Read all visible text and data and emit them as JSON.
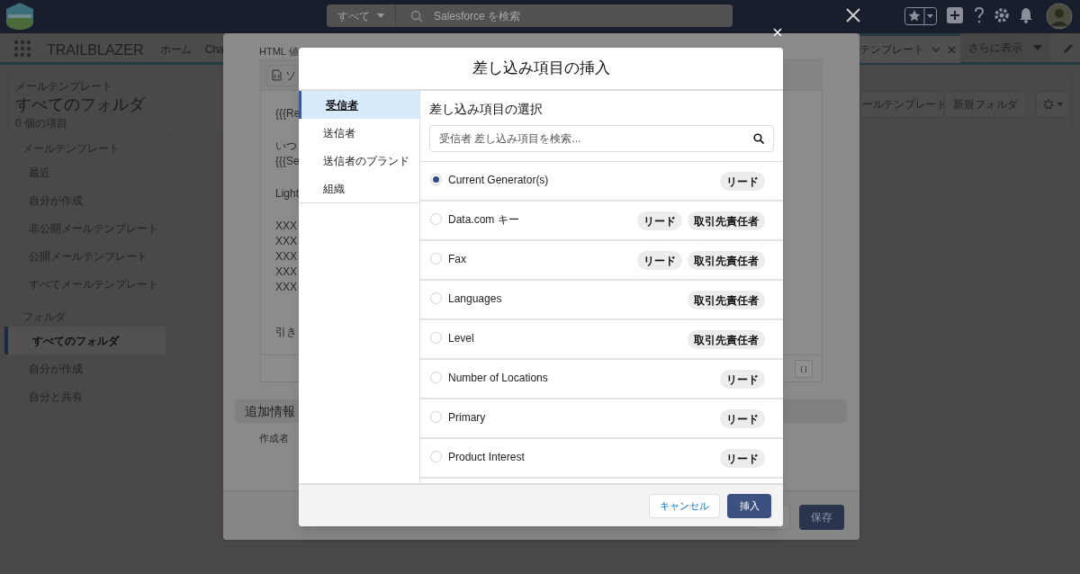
{
  "header": {
    "search_scope": "すべて",
    "search_placeholder": "Salesforce を検索"
  },
  "nav": {
    "app_name": "TRAILBLAZER",
    "tabs": [
      {
        "label": "ホーム",
        "selected": false
      },
      {
        "label": "Cha",
        "selected": false
      }
    ],
    "open_tab": {
      "label": "テンプレート",
      "selected": true
    },
    "more": "さらに表示"
  },
  "page": {
    "object_label": "メールテンプレート",
    "title": "すべてのフォルダ",
    "count": "0 個の項目",
    "buttons": [
      "ールテンプレート",
      "新規フォルダ"
    ]
  },
  "sidebar": {
    "sections": [
      {
        "heading": "メールテンプレート",
        "items": [
          {
            "label": "最近",
            "selected": false
          },
          {
            "label": "自分が作成",
            "selected": false
          },
          {
            "label": "非公開メールテンプレート",
            "selected": false
          },
          {
            "label": "公開メールテンプレート",
            "selected": false
          },
          {
            "label": "すべてメールテンプレート",
            "selected": false
          }
        ]
      },
      {
        "heading": "フォルダ",
        "items": [
          {
            "label": "すべてのフォルダ",
            "selected": true
          },
          {
            "label": "自分が作成",
            "selected": false
          },
          {
            "label": "自分と共有",
            "selected": false
          }
        ]
      }
    ]
  },
  "editor_dialog": {
    "field_label": "HTML 値",
    "toolbar_button": "ソ",
    "paragraphs": [
      [
        "{{{Re"
      ],
      [
        "いつ",
        "{{{Se"
      ],
      [
        "Light"
      ],
      [
        "XXX",
        "XXX",
        "XXX",
        "XXX",
        "XXX"
      ],
      [
        "引き"
      ]
    ],
    "merge_button": "{ }",
    "section": "追加情報",
    "field_label_2": "作成者",
    "save_button": "保存"
  },
  "merge_dialog": {
    "title": "差し込み項目の挿入",
    "categories": [
      {
        "label": "受信者",
        "selected": true
      },
      {
        "label": "送信者",
        "selected": false
      },
      {
        "label": "送信者のブランド",
        "selected": false
      },
      {
        "label": "組織",
        "selected": false
      }
    ],
    "heading": "差し込み項目の選択",
    "search_placeholder": "受信者 差し込み項目を検索...",
    "fields": [
      {
        "name": "Current Generator(s)",
        "selected": true,
        "tags": [
          "リード"
        ]
      },
      {
        "name": "Data.com キー",
        "selected": false,
        "tags": [
          "リード",
          "取引先責任者"
        ]
      },
      {
        "name": "Fax",
        "selected": false,
        "tags": [
          "リード",
          "取引先責任者"
        ]
      },
      {
        "name": "Languages",
        "selected": false,
        "tags": [
          "取引先責任者"
        ]
      },
      {
        "name": "Level",
        "selected": false,
        "tags": [
          "取引先責任者"
        ]
      },
      {
        "name": "Number of Locations",
        "selected": false,
        "tags": [
          "リード"
        ]
      },
      {
        "name": "Primary",
        "selected": false,
        "tags": [
          "リード"
        ]
      },
      {
        "name": "Product Interest",
        "selected": false,
        "tags": [
          "リード"
        ]
      }
    ],
    "cancel": "キャンセル",
    "insert": "挿入"
  }
}
